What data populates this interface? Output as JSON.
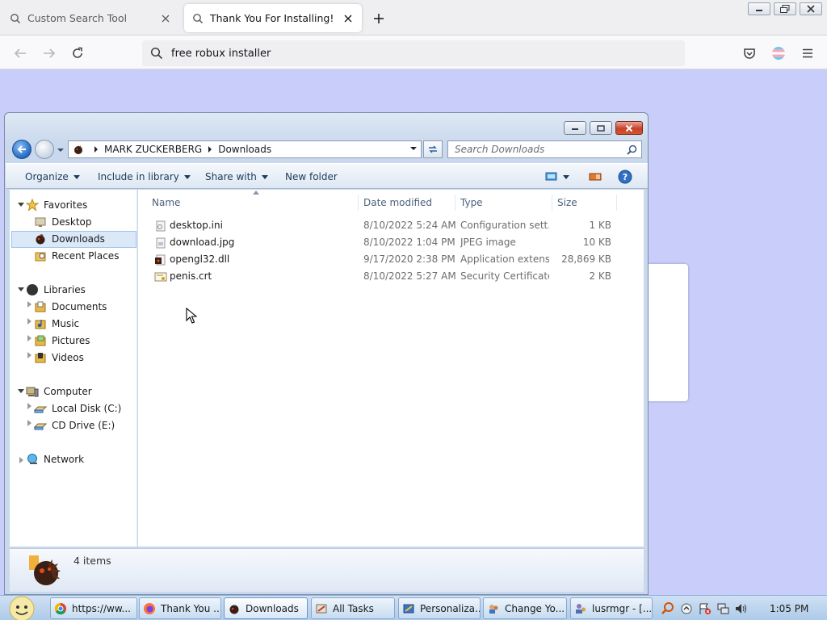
{
  "browser": {
    "tabs": [
      {
        "label": "Custom Search Tool",
        "active": false
      },
      {
        "label": "Thank You For Installing!",
        "active": true
      }
    ],
    "url": "free robux installer"
  },
  "explorer": {
    "breadcrumb": [
      "MARK ZUCKERBERG",
      "Downloads"
    ],
    "search_placeholder": "Search Downloads",
    "toolbar": {
      "organize": "Organize",
      "include_library": "Include in library",
      "share_with": "Share with",
      "new_folder": "New folder"
    },
    "nav": {
      "favorites": "Favorites",
      "desktop": "Desktop",
      "downloads": "Downloads",
      "recent": "Recent Places",
      "libraries": "Libraries",
      "documents": "Documents",
      "music": "Music",
      "pictures": "Pictures",
      "videos": "Videos",
      "computer": "Computer",
      "local_disk": "Local Disk (C:)",
      "cd_drive": "CD Drive (E:)",
      "network": "Network"
    },
    "columns": [
      "Name",
      "Date modified",
      "Type",
      "Size"
    ],
    "files": [
      {
        "name": "desktop.ini",
        "date": "8/10/2022 5:24 AM",
        "type": "Configuration sett...",
        "size": "1 KB"
      },
      {
        "name": "download.jpg",
        "date": "8/10/2022 1:04 PM",
        "type": "JPEG image",
        "size": "10 KB"
      },
      {
        "name": "opengl32.dll",
        "date": "9/17/2020 2:38 PM",
        "type": "Application extens...",
        "size": "28,869 KB"
      },
      {
        "name": "penis.crt",
        "date": "8/10/2022 5:27 AM",
        "type": "Security Certificate",
        "size": "2 KB"
      }
    ],
    "items_count": "4 items"
  },
  "taskbar": {
    "items": [
      "https://ww...",
      "Thank You ...",
      "Downloads",
      "All Tasks",
      "Personaliza...",
      "Change Yo...",
      "lusrmgr - [..."
    ],
    "clock": "1:05 PM"
  },
  "colors": {
    "page_bg": "#c8cdfa",
    "selection": "#dbe8f8",
    "close_red": "#c8412a"
  }
}
